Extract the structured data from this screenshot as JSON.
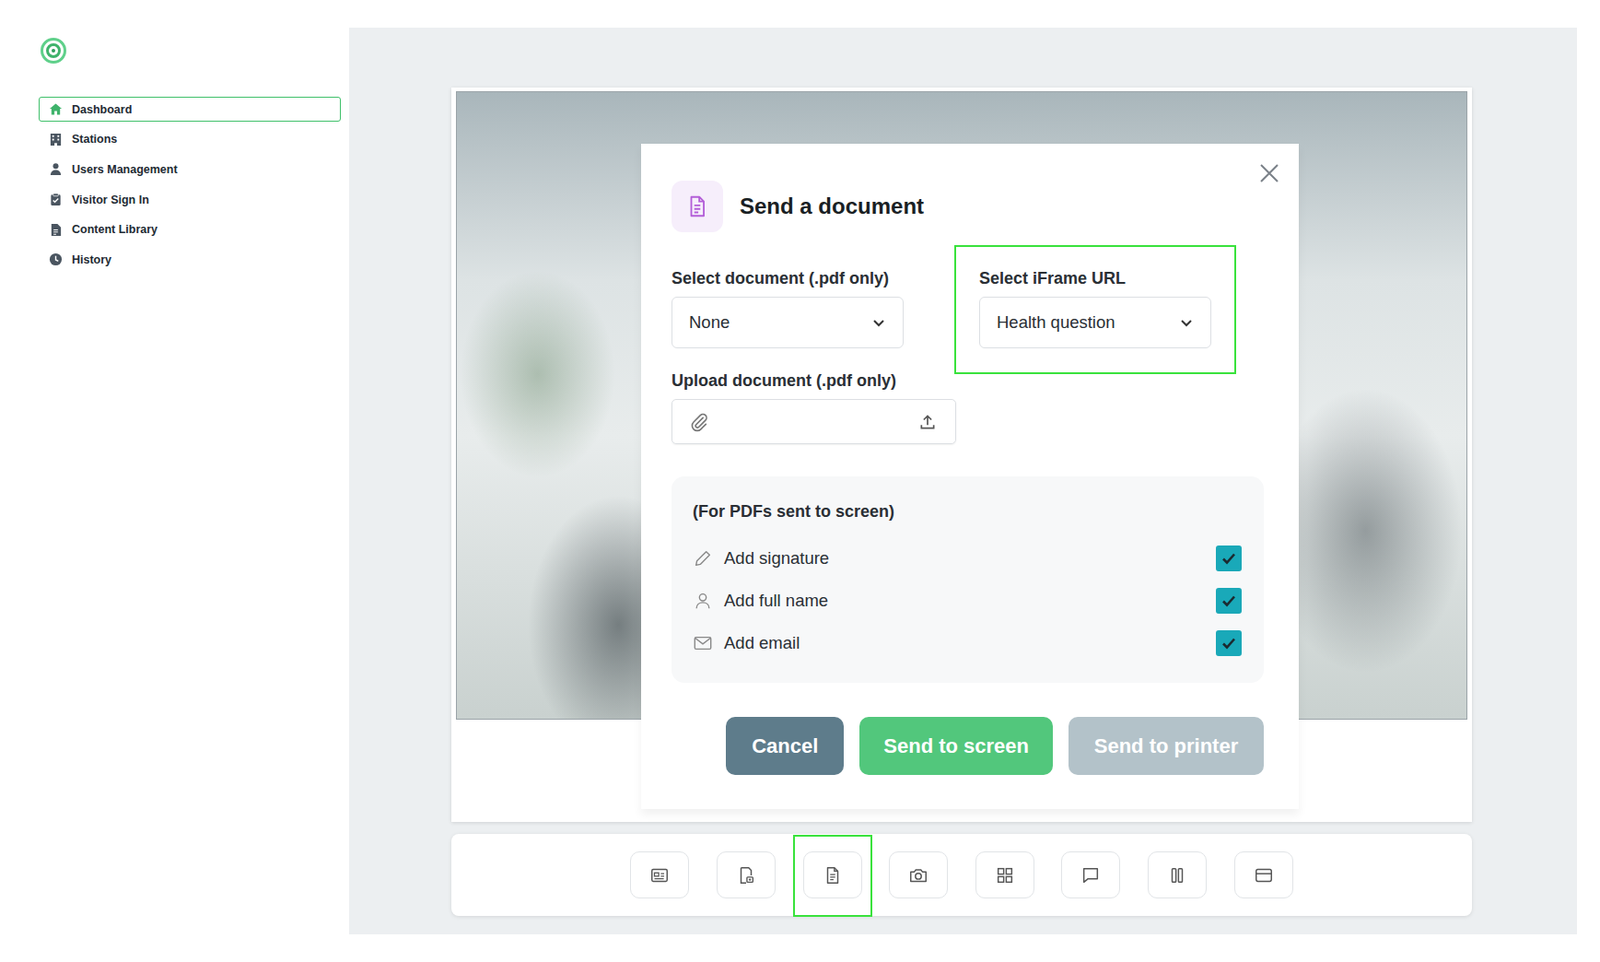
{
  "sidebar": {
    "items": [
      {
        "label": "Dashboard",
        "kind": "home",
        "selected": true
      },
      {
        "label": "Stations",
        "kind": "building",
        "selected": false
      },
      {
        "label": "Users Management",
        "kind": "user",
        "selected": false
      },
      {
        "label": "Visitor Sign In",
        "kind": "clipboard",
        "selected": false
      },
      {
        "label": "Content Library",
        "kind": "file",
        "selected": false
      },
      {
        "label": "History",
        "kind": "clock",
        "selected": false
      }
    ]
  },
  "dialog": {
    "title": "Send a document",
    "document": {
      "label": "Select document (.pdf only)",
      "value": "None"
    },
    "iframe": {
      "label": "Select iFrame URL",
      "value": "Health question",
      "highlighted": true
    },
    "upload": {
      "label": "Upload document (.pdf only)"
    },
    "options": {
      "heading": "(For PDFs sent to screen)",
      "items": [
        {
          "label": "Add signature",
          "kind": "pen",
          "checked": true
        },
        {
          "label": "Add full name",
          "kind": "person",
          "checked": true
        },
        {
          "label": "Add email",
          "kind": "mail",
          "checked": true
        }
      ]
    },
    "buttons": [
      {
        "label": "Cancel",
        "kind": "cancel",
        "disabled": false
      },
      {
        "label": "Send to screen",
        "kind": "primary",
        "disabled": false
      },
      {
        "label": "Send to printer",
        "kind": "primary",
        "disabled": true
      }
    ]
  },
  "toolbar": [
    {
      "kind": "id-card",
      "selected": false
    },
    {
      "kind": "document-scan",
      "selected": false
    },
    {
      "kind": "document",
      "selected": true
    },
    {
      "kind": "camera",
      "selected": false
    },
    {
      "kind": "grid",
      "selected": false
    },
    {
      "kind": "chat",
      "selected": false
    },
    {
      "kind": "columns",
      "selected": false
    },
    {
      "kind": "card",
      "selected": false
    }
  ]
}
